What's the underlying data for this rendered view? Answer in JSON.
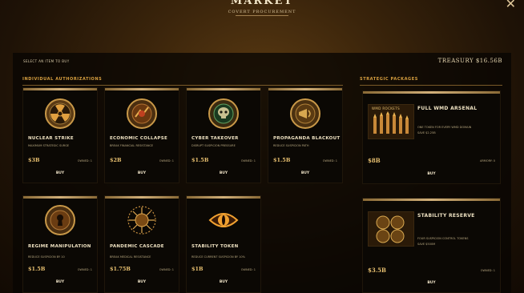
{
  "header": {
    "title": "MARKET",
    "subtitle": "COVERT PROCUREMENT",
    "close": "✕"
  },
  "select_label": "SELECT AN ITEM TO BUY",
  "treasury": "TREASURY  $16.56B",
  "sections": {
    "individual": "INDIVIDUAL AUTHORIZATIONS",
    "strategic": "STRATEGIC PACKAGES"
  },
  "items": [
    {
      "title": "NUCLEAR STRIKE",
      "desc": "MAXIMUM STRATEGIC SURGE",
      "price": "$3B",
      "owned": "OWNED: 1",
      "buy": "BUY",
      "icon": "radiation-icon"
    },
    {
      "title": "ECONOMIC COLLAPSE",
      "desc": "BREAK FINANCIAL RESISTANCE",
      "price": "$2B",
      "owned": "OWNED: 1",
      "buy": "BUY",
      "icon": "economic-collapse-icon"
    },
    {
      "title": "CYBER TAKEOVER",
      "desc": "DISRUPT SUSPICION PRESSURE",
      "price": "$1.5B",
      "owned": "OWNED: 1",
      "buy": "BUY",
      "icon": "cyber-skull-icon"
    },
    {
      "title": "PROPAGANDA BLACKOUT",
      "desc": "REDUCE SUSPICION PATH",
      "price": "$1.5B",
      "owned": "OWNED: 1",
      "buy": "BUY",
      "icon": "propaganda-icon"
    },
    {
      "title": "REGIME MANIPULATION",
      "desc": "REDUCE SUSPICION BY 10",
      "price": "$1.5B",
      "owned": "OWNED: 1",
      "buy": "BUY",
      "icon": "regime-keyhole-icon"
    },
    {
      "title": "PANDEMIC CASCADE",
      "desc": "BREAK MEDICAL RESISTANCE",
      "price": "$1.75B",
      "owned": "OWNED: 1",
      "buy": "BUY",
      "icon": "pandemic-icon"
    },
    {
      "title": "STABILITY TOKEN",
      "desc": "REDUCE CURRENT SUSPICION BY 10%",
      "price": "$1B",
      "owned": "OWNED: 1",
      "buy": "BUY",
      "icon": "eye-icon"
    }
  ],
  "packages": [
    {
      "title": "FULL WMD ARSENAL",
      "img_label": "WMD ROCKETS",
      "desc1": "ONE TOKEN FOR EVERY WMD DOMAIN",
      "desc2": "SAVE $2.25B",
      "price": "$8B",
      "owned": "ARMORY: 0",
      "buy": "BUY"
    },
    {
      "title": "STABILITY RESERVE",
      "desc1": "FOUR SUSPICION CONTROL TOKENS",
      "desc2": "SAVE $500M",
      "price": "$3.5B",
      "owned": "OWNED: 1",
      "buy": "BUY"
    }
  ],
  "colors": {
    "accent": "#d2b07a",
    "price": "#e8c070",
    "section": "#d8a040"
  }
}
